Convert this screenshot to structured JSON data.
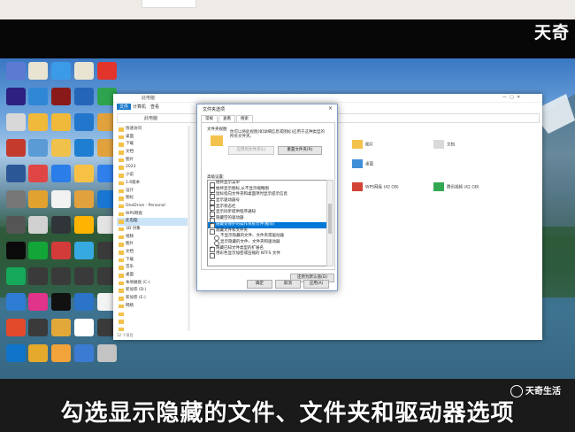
{
  "watermark_top": "天奇",
  "watermark_bottom": "天奇生活",
  "caption": "勾选显示隐藏的文件、文件夹和驱动器选项",
  "desktop_icons": [
    {
      "label": "",
      "color": "#5d7ad3"
    },
    {
      "label": "",
      "color": "#e9e4d2"
    },
    {
      "label": "",
      "color": "#3c9be8"
    },
    {
      "label": "",
      "color": "#e9e4d2"
    },
    {
      "label": "",
      "color": "#e2342b"
    },
    {
      "label": "",
      "color": "#2d2080"
    },
    {
      "label": "",
      "color": "#2f87d5"
    },
    {
      "label": "",
      "color": "#8a1a1a"
    },
    {
      "label": "",
      "color": "#2565b8"
    },
    {
      "label": "",
      "color": "#2ea44f"
    },
    {
      "label": "",
      "color": "#d8d8d8"
    },
    {
      "label": "",
      "color": "#f0b93a"
    },
    {
      "label": "",
      "color": "#f0b93a"
    },
    {
      "label": "",
      "color": "#2277cc"
    },
    {
      "label": "",
      "color": "#e1a23d"
    },
    {
      "label": "",
      "color": "#c43b2e"
    },
    {
      "label": "",
      "color": "#5b9bd5"
    },
    {
      "label": "",
      "color": "#f0c14b"
    },
    {
      "label": "",
      "color": "#1e7fd2"
    },
    {
      "label": "",
      "color": "#e1a23d"
    },
    {
      "label": "",
      "color": "#2b5797"
    },
    {
      "label": "",
      "color": "#e04545"
    },
    {
      "label": "",
      "color": "#2b7de9"
    },
    {
      "label": "",
      "color": "#f7c145"
    },
    {
      "label": "",
      "color": "#2f80ed"
    },
    {
      "label": "",
      "color": "#777777"
    },
    {
      "label": "",
      "color": "#e2a22f"
    },
    {
      "label": "",
      "color": "#f2f2f2"
    },
    {
      "label": "",
      "color": "#e1a23d"
    },
    {
      "label": "",
      "color": "#1976d2"
    },
    {
      "label": "",
      "color": "#555555"
    },
    {
      "label": "",
      "color": "#d1d1d1"
    },
    {
      "label": "",
      "color": "#30353a"
    },
    {
      "label": "",
      "color": "#ffb400"
    },
    {
      "label": "",
      "color": "#e3e3e3"
    },
    {
      "label": "",
      "color": "#0a0a0a"
    },
    {
      "label": "",
      "color": "#13a538"
    },
    {
      "label": "",
      "color": "#d33b3b"
    },
    {
      "label": "",
      "color": "#36a9e1"
    },
    {
      "label": "",
      "color": "#3a3a3a"
    },
    {
      "label": "",
      "color": "#15a85a"
    },
    {
      "label": "",
      "color": "#3a3a3a"
    },
    {
      "label": "",
      "color": "#3a3a3a"
    },
    {
      "label": "",
      "color": "#3a3a3a"
    },
    {
      "label": "",
      "color": "#3a3a3a"
    },
    {
      "label": "",
      "color": "#2e7cd3"
    },
    {
      "label": "",
      "color": "#e0338a"
    },
    {
      "label": "",
      "color": "#111111"
    },
    {
      "label": "",
      "color": "#2b74c9"
    },
    {
      "label": "",
      "color": "#f3f3f3"
    },
    {
      "label": "",
      "color": "#e24a2b"
    },
    {
      "label": "",
      "color": "#3a3a3a"
    },
    {
      "label": "",
      "color": "#e2a93a"
    },
    {
      "label": "",
      "color": "#ffffff"
    },
    {
      "label": "",
      "color": "#3a3a3a"
    },
    {
      "label": "",
      "color": "#0f74c9"
    },
    {
      "label": "",
      "color": "#e5a92c"
    },
    {
      "label": "",
      "color": "#f2a33a"
    },
    {
      "label": "",
      "color": "#3c7bd3"
    },
    {
      "label": "",
      "color": "#c3c3c3"
    }
  ],
  "explorer": {
    "title": "此电脑",
    "tabs": [
      "文件",
      "计算机",
      "查看"
    ],
    "address": "此电脑",
    "nav": [
      "快速访问",
      "桌面",
      "下载",
      "文档",
      "图片",
      "2023",
      "小说",
      "1.6版本",
      "设计",
      "图标",
      "OneDrive - Personal",
      "WPS网盘",
      "此电脑",
      "3D 对象",
      "视频",
      "图片",
      "文档",
      "下载",
      "音乐",
      "桌面",
      "本地磁盘 (C:)",
      "新加卷 (D:)",
      "新加卷 (E:)",
      "网络",
      "",
      "",
      ""
    ],
    "nav_selected": 12,
    "status": "12 个项目",
    "folders": [
      {
        "name": "图片",
        "color": "#f3c24c"
      },
      {
        "name": "文档",
        "color": "#d9d9d9"
      },
      {
        "name": "桌面",
        "color": "#3f8fd8"
      },
      {
        "name": "WPS网盘 (42 GB)",
        "color": "#d14437"
      },
      {
        "name": "腾讯视频 (42 GB)",
        "color": "#33a852"
      }
    ]
  },
  "dialog": {
    "title": "文件夹选项",
    "close": "×",
    "tabs": [
      "常规",
      "查看",
      "搜索"
    ],
    "active_tab": 1,
    "folder_views_label": "文件夹视图",
    "folder_views_desc": "你可以将此视图(如详细信息或图标)应用于这种类型的所有文件夹。",
    "apply_folders": "应用到文件夹(L)",
    "reset_folders": "重置文件夹(R)",
    "advanced_label": "高级设置:",
    "advanced_items": [
      {
        "text": "始终显示菜单",
        "state": "unchecked"
      },
      {
        "text": "始终显示图标,从不显示缩略图",
        "state": "unchecked"
      },
      {
        "text": "鼠标指向文件夹和桌面项时显示提示信息",
        "state": "checked"
      },
      {
        "text": "显示驱动器号",
        "state": "checked"
      },
      {
        "text": "显示状态栏",
        "state": "checked"
      },
      {
        "text": "显示同步提供程序通知",
        "state": "checked"
      },
      {
        "text": "隐藏空的驱动器",
        "state": "checked"
      },
      {
        "text": "隐藏受保护的操作系统文件(推荐)",
        "state": "checked",
        "highlight": true
      },
      {
        "text": "隐藏文件和文件夹",
        "state": "folder"
      },
      {
        "text": "不显示隐藏的文件、文件夹或驱动器",
        "state": "radio"
      },
      {
        "text": "显示隐藏的文件、文件夹和驱动器",
        "state": "radio"
      },
      {
        "text": "隐藏已知文件类型的扩展名",
        "state": "checked"
      },
      {
        "text": "用彩色显示加密或压缩的 NTFS 文件",
        "state": "unchecked"
      }
    ],
    "restore_defaults": "还原为默认值(D)",
    "ok": "确定",
    "cancel": "取消",
    "apply": "应用(A)"
  }
}
